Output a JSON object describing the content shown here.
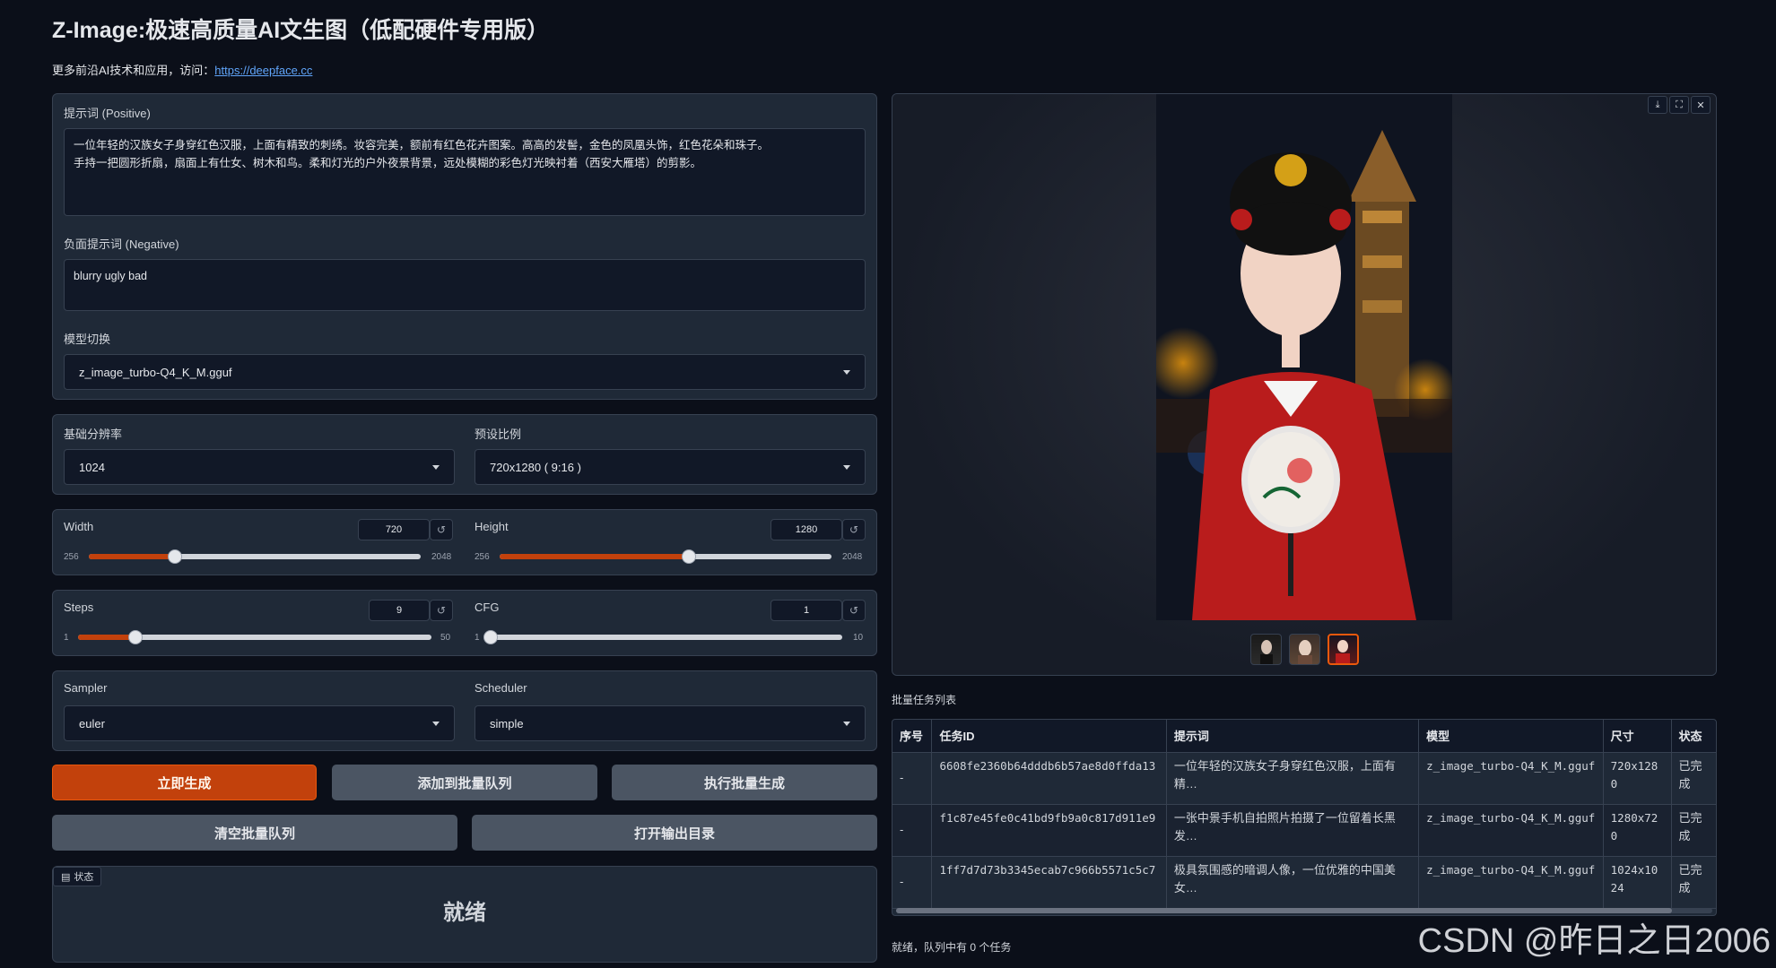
{
  "header": {
    "title": "Z-Image:极速高质量AI文生图（低配硬件专用版）",
    "subtitle_prefix": "更多前沿AI技术和应用，访问：",
    "subtitle_link": "https://deepface.cc"
  },
  "prompt": {
    "positive_label": "提示词 (Positive)",
    "positive_value": "一位年轻的汉族女子身穿红色汉服，上面有精致的刺绣。妆容完美，额前有红色花卉图案。高高的发髻，金色的凤凰头饰，红色花朵和珠子。\n手持一把圆形折扇，扇面上有仕女、树木和鸟。柔和灯光的户外夜景背景，远处模糊的彩色灯光映衬着（西安大雁塔）的剪影。",
    "negative_label": "负面提示词 (Negative)",
    "negative_value": "blurry ugly bad",
    "model_label": "模型切换",
    "model_value": "z_image_turbo-Q4_K_M.gguf"
  },
  "resolution": {
    "base_label": "基础分辨率",
    "base_value": "1024",
    "ratio_label": "预设比例",
    "ratio_value": "720x1280 ( 9:16 )"
  },
  "sliders": {
    "width": {
      "label": "Width",
      "value": "720",
      "min": "256",
      "max": "2048",
      "fraction": 0.26
    },
    "height": {
      "label": "Height",
      "value": "1280",
      "min": "256",
      "max": "2048",
      "fraction": 0.571
    },
    "steps": {
      "label": "Steps",
      "value": "9",
      "min": "1",
      "max": "50",
      "fraction": 0.163
    },
    "cfg": {
      "label": "CFG",
      "value": "1",
      "min": "1",
      "max": "10",
      "fraction": 0.0
    }
  },
  "sampler": {
    "sampler_label": "Sampler",
    "sampler_value": "euler",
    "scheduler_label": "Scheduler",
    "scheduler_value": "simple"
  },
  "buttons": {
    "generate": "立即生成",
    "add_batch": "添加到批量队列",
    "run_batch": "执行批量生成",
    "clear_batch": "清空批量队列",
    "open_output": "打开输出目录"
  },
  "status": {
    "tag": "状态",
    "text": "就绪"
  },
  "icons": {
    "reset": "↺",
    "download": "⤓",
    "fullscreen": "⛶",
    "close": "✕",
    "status": "▤"
  },
  "batch": {
    "label": "批量任务列表",
    "columns": [
      "序号",
      "任务ID",
      "提示词",
      "模型",
      "尺寸",
      "状态"
    ],
    "rows": [
      {
        "index": "-",
        "task_id": "6608fe2360b64dddb6b57ae8d0ffda13",
        "prompt": "一位年轻的汉族女子身穿红色汉服，上面有精…",
        "model": "z_image_turbo-Q4_K_M.gguf",
        "size": "720x1280",
        "status": "已完成"
      },
      {
        "index": "-",
        "task_id": "f1c87e45fe0c41bd9fb9a0c817d911e9",
        "prompt": "一张中景手机自拍照片拍摄了一位留着长黑发…",
        "model": "z_image_turbo-Q4_K_M.gguf",
        "size": "1280x720",
        "status": "已完成"
      },
      {
        "index": "-",
        "task_id": "1ff7d7d73b3345ecab7c966b5571c5c7",
        "prompt": "极具氛围感的暗调人像，一位优雅的中国美女…",
        "model": "z_image_turbo-Q4_K_M.gguf",
        "size": "1024x1024",
        "status": "已完成"
      }
    ],
    "footer": "就绪，队列中有 0 个任务"
  },
  "watermark": "CSDN @昨日之日2006",
  "colors": {
    "accent": "#c2410c",
    "background": "#0b0f19",
    "panel": "#1f2937"
  }
}
